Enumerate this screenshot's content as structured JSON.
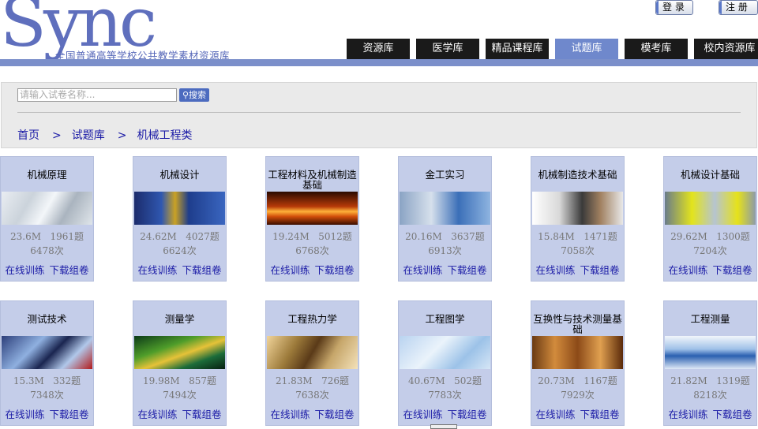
{
  "brand": {
    "logo": "Sync",
    "subtitle": "全国普通高等学校公共教学素材资源库"
  },
  "top_buttons": {
    "login": "登 录",
    "register": "注 册"
  },
  "nav": {
    "tabs": [
      {
        "label": "资源库",
        "active": false
      },
      {
        "label": "医学库",
        "active": false
      },
      {
        "label": "精品课程库",
        "active": false
      },
      {
        "label": "试题库",
        "active": true
      },
      {
        "label": "模考库",
        "active": false
      },
      {
        "label": "校内资源库",
        "active": false
      }
    ]
  },
  "search": {
    "placeholder": "请输入试卷名称...",
    "button_label": "搜索"
  },
  "breadcrumb": {
    "home": "首页",
    "sep": ">",
    "level1": "试题库",
    "level2": "机械工程类"
  },
  "cards": [
    {
      "title": "机械原理",
      "size": "23.6M",
      "questions": "1961题",
      "count": "6478次",
      "train": "在线训练",
      "download": "下载组卷",
      "img": "gear-photo"
    },
    {
      "title": "机械设计",
      "size": "24.62M",
      "questions": "4027题",
      "count": "6624次",
      "train": "在线训练",
      "download": "下载组卷",
      "img": "surveyor-photo"
    },
    {
      "title": "工程材料及机械制造基础",
      "size": "19.24M",
      "questions": "5012题",
      "count": "6768次",
      "train": "在线训练",
      "download": "下载组卷",
      "img": "fire-photo"
    },
    {
      "title": "金工实习",
      "size": "20.16M",
      "questions": "3637题",
      "count": "6913次",
      "train": "在线训练",
      "download": "下载组卷",
      "img": "brain-gear-photo"
    },
    {
      "title": "机械制造技术基础",
      "size": "15.84M",
      "questions": "1471题",
      "count": "7058次",
      "train": "在线训练",
      "download": "下载组卷",
      "img": "gears-photo"
    },
    {
      "title": "机械设计基础",
      "size": "29.62M",
      "questions": "1300题",
      "count": "7204次",
      "train": "在线训练",
      "download": "下载组卷",
      "img": "workers-photo"
    },
    {
      "title": "测试技术",
      "size": "15.3M",
      "questions": "332题",
      "count": "7348次",
      "train": "在线训练",
      "download": "下载组卷",
      "img": "building-photo"
    },
    {
      "title": "测量学",
      "size": "19.98M",
      "questions": "857题",
      "count": "7494次",
      "train": "在线训练",
      "download": "下载组卷",
      "img": "swirl-photo"
    },
    {
      "title": "工程热力学",
      "size": "21.83M",
      "questions": "726题",
      "count": "7638次",
      "train": "在线训练",
      "download": "下载组卷",
      "img": "pipes-photo"
    },
    {
      "title": "工程图学",
      "size": "40.67M",
      "questions": "502题",
      "count": "7783次",
      "train": "在线训练",
      "download": "下载组卷",
      "img": "blueprint-photo"
    },
    {
      "title": "互换性与技术测量基础",
      "size": "20.73M",
      "questions": "1167题",
      "count": "7929次",
      "train": "在线训练",
      "download": "下载组卷",
      "img": "bread-photo"
    },
    {
      "title": "工程测量",
      "size": "21.82M",
      "questions": "1319题",
      "count": "8218次",
      "train": "在线训练",
      "download": "下载组卷",
      "img": "wave-photo"
    }
  ]
}
